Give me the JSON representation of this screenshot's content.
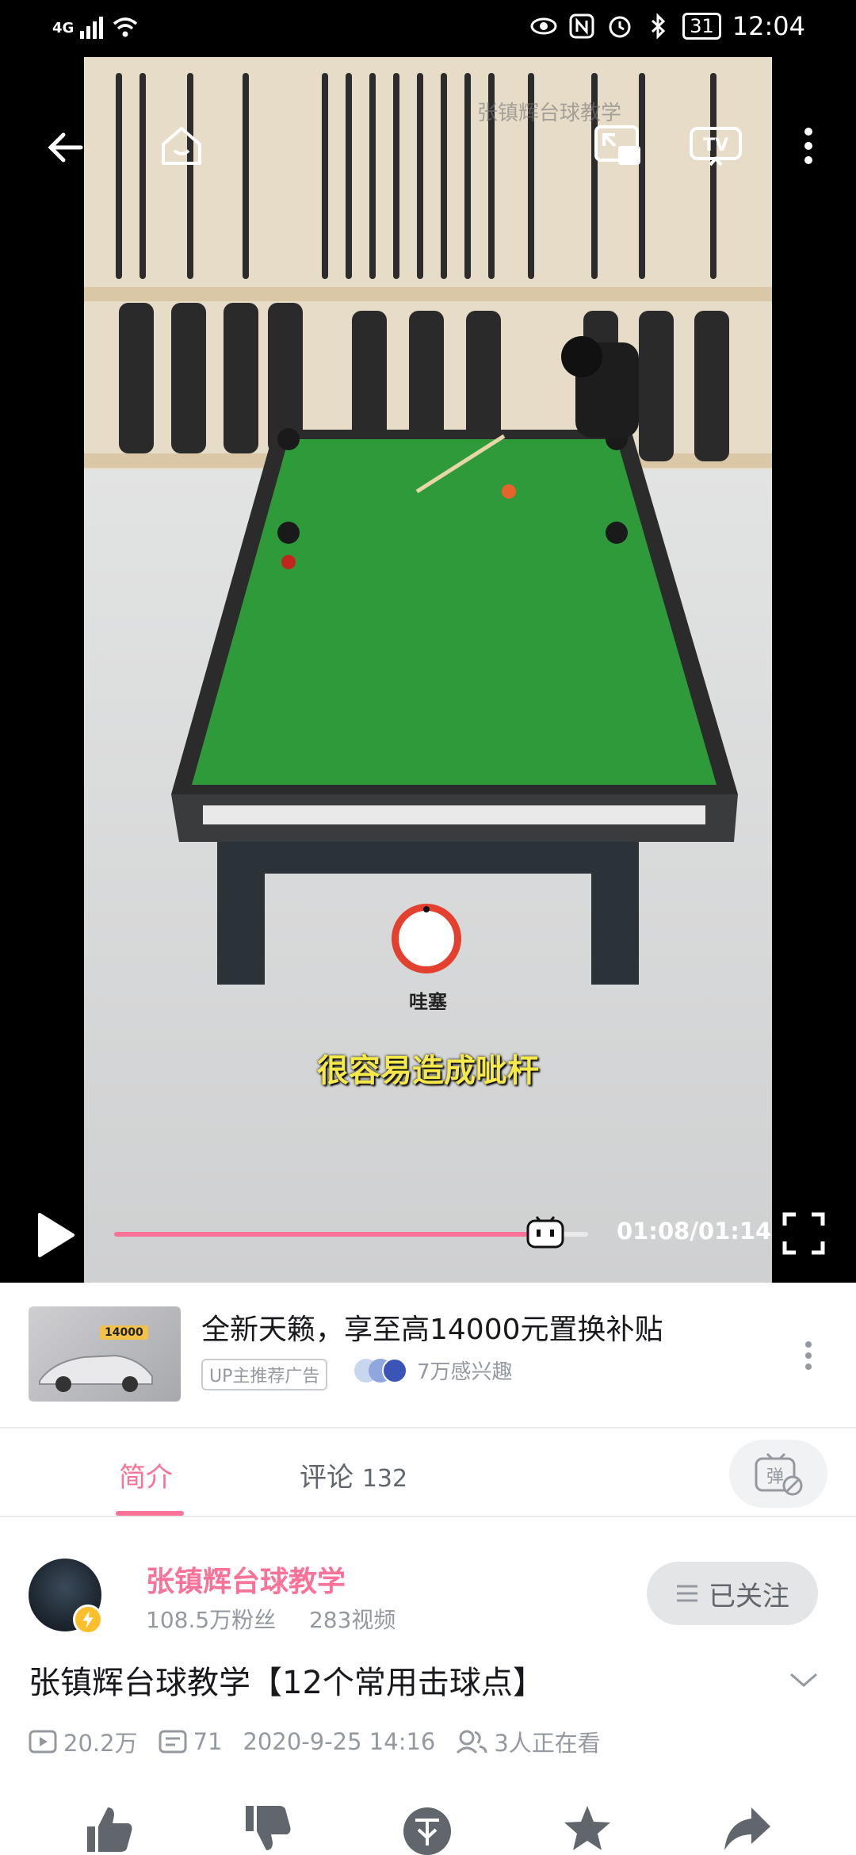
{
  "status": {
    "network": "4G",
    "battery": "31",
    "time": "12:04"
  },
  "video": {
    "watermark": "张镇辉台球教学",
    "target_label": "哇塞",
    "subtitle": "很容易造成呲杆",
    "time_display": "01:08/01:14",
    "progress_fraction": 0.91,
    "controls": [
      "back-icon",
      "home-icon",
      "pip-icon",
      "tv-icon",
      "more-icon",
      "play-icon",
      "fullscreen-icon"
    ]
  },
  "ad": {
    "title": "全新天籁，享至高14000元置换补贴",
    "tag": "UP主推荐广告",
    "interest": "7万感兴趣",
    "thumb_badge": "14000"
  },
  "tabs": {
    "intro": "简介",
    "comments": "评论",
    "comment_count": "132",
    "danmu_icon": "弹"
  },
  "uploader": {
    "name": "张镇辉台球教学",
    "fans": "108.5万粉丝",
    "videos": "283视频",
    "follow_label": "已关注"
  },
  "detail": {
    "title": "张镇辉台球教学【12个常用击球点】",
    "views": "20.2万",
    "danmaku": "71",
    "date": "2020-9-25 14:16",
    "watching": "3人正在看"
  },
  "colors": {
    "accent": "#fb7299",
    "subtitle": "#f5e84a",
    "table_felt": "#2e9a3a"
  }
}
